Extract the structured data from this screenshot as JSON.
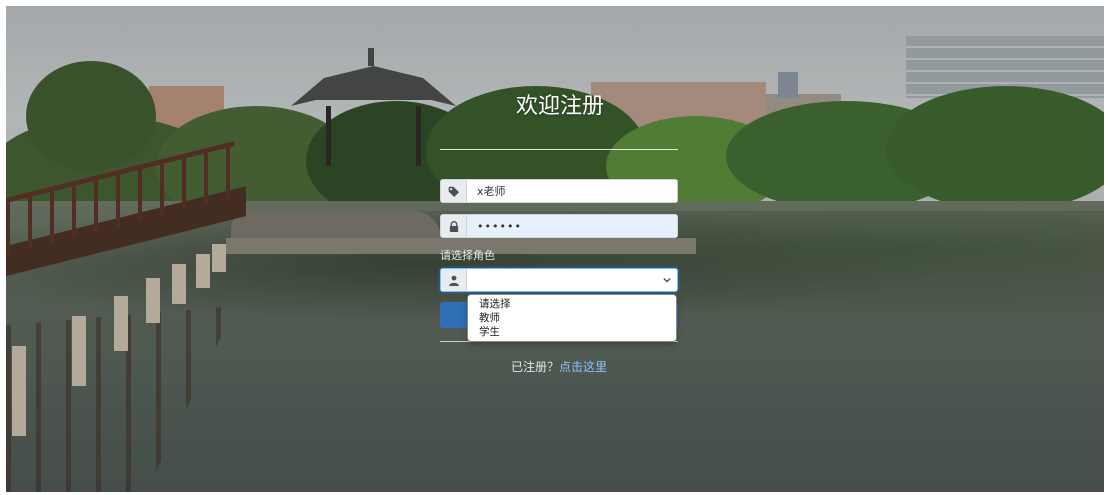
{
  "form": {
    "title": "欢迎注册",
    "username_value": "x老师",
    "password_value": "••••••",
    "role_label": "请选择角色",
    "role_options": [
      "请选择",
      "教师",
      "学生"
    ],
    "footer_prefix": "已注册？",
    "footer_link": "点击这里"
  },
  "icons": {
    "username": "tag-icon",
    "password": "lock-icon",
    "role": "user-icon",
    "select": "chevron-down-icon"
  },
  "colors": {
    "submit_button": "#2f6fb5",
    "link": "#8ec3ff",
    "focus_outline": "#80bdff"
  }
}
